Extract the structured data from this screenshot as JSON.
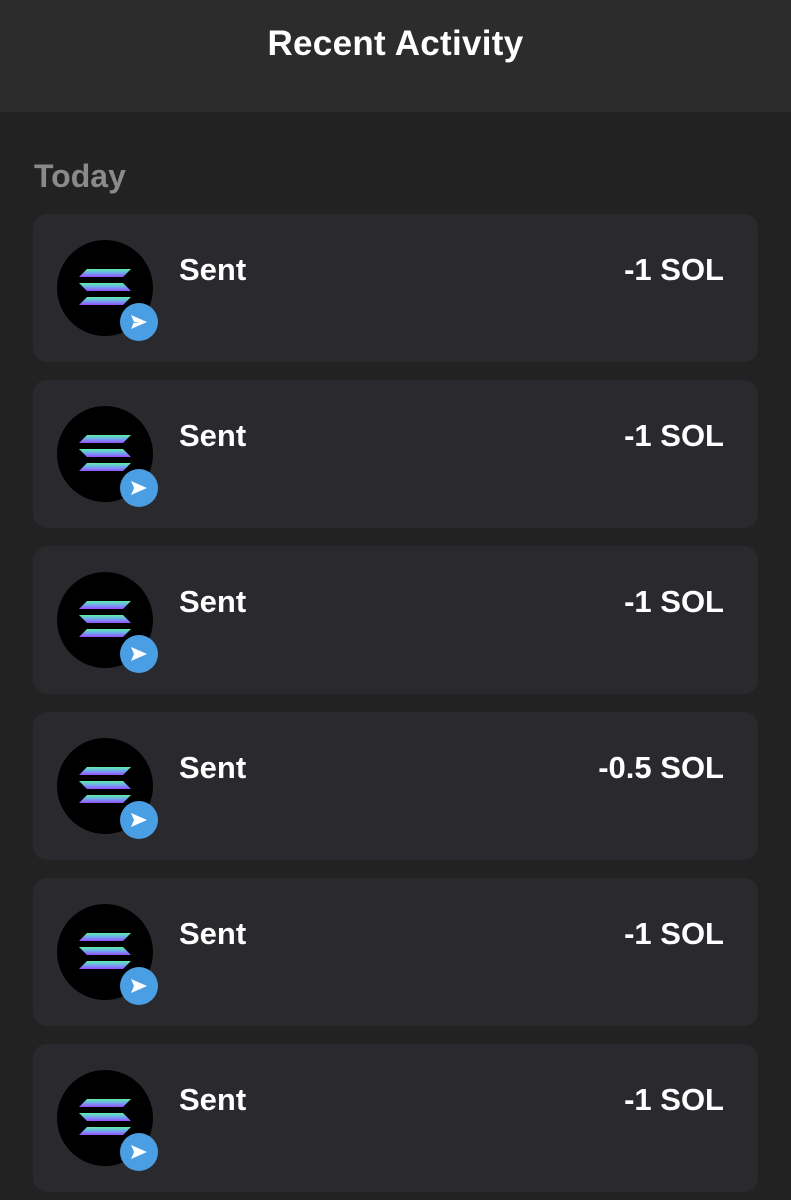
{
  "header": {
    "title": "Recent Activity"
  },
  "sections": [
    {
      "label": "Today",
      "items": [
        {
          "type": "Sent",
          "amount": "-1 SOL",
          "icon": "solana-logo-icon",
          "badge_icon": "send-arrow-icon"
        },
        {
          "type": "Sent",
          "amount": "-1 SOL",
          "icon": "solana-logo-icon",
          "badge_icon": "send-arrow-icon"
        },
        {
          "type": "Sent",
          "amount": "-1 SOL",
          "icon": "solana-logo-icon",
          "badge_icon": "send-arrow-icon"
        },
        {
          "type": "Sent",
          "amount": "-0.5 SOL",
          "icon": "solana-logo-icon",
          "badge_icon": "send-arrow-icon"
        },
        {
          "type": "Sent",
          "amount": "-1 SOL",
          "icon": "solana-logo-icon",
          "badge_icon": "send-arrow-icon"
        },
        {
          "type": "Sent",
          "amount": "-1 SOL",
          "icon": "solana-logo-icon",
          "badge_icon": "send-arrow-icon"
        }
      ]
    }
  ],
  "colors": {
    "background": "#222222",
    "header_background": "#2c2c2d",
    "row_background": "#2a2a2e",
    "section_label": "#8a8a8c",
    "badge_blue": "#4a9ee4",
    "solana_gradient_start": "#5ef0a5",
    "solana_gradient_end": "#9b4dff"
  }
}
